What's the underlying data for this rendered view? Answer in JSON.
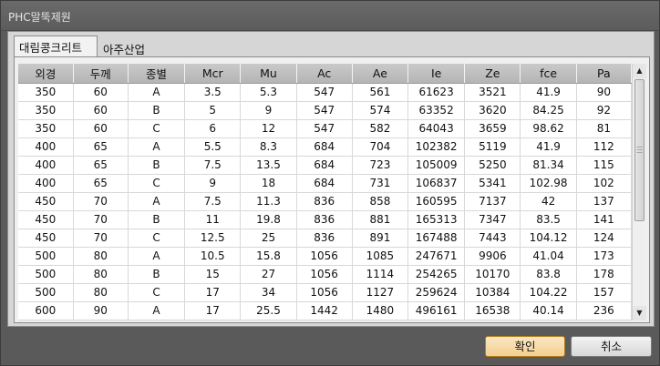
{
  "window": {
    "title": "PHC말뚝제원"
  },
  "tabs": [
    {
      "label": "대림콩크리트",
      "active": true
    },
    {
      "label": "아주산업",
      "active": false
    }
  ],
  "table": {
    "columns": [
      "외경",
      "두께",
      "종별",
      "Mcr",
      "Mu",
      "Ac",
      "Ae",
      "Ie",
      "Ze",
      "fce",
      "Pa"
    ],
    "rows": [
      [
        "350",
        "60",
        "A",
        "3.5",
        "5.3",
        "547",
        "561",
        "61623",
        "3521",
        "41.9",
        "90"
      ],
      [
        "350",
        "60",
        "B",
        "5",
        "9",
        "547",
        "574",
        "63352",
        "3620",
        "84.25",
        "92"
      ],
      [
        "350",
        "60",
        "C",
        "6",
        "12",
        "547",
        "582",
        "64043",
        "3659",
        "98.62",
        "81"
      ],
      [
        "400",
        "65",
        "A",
        "5.5",
        "8.3",
        "684",
        "704",
        "102382",
        "5119",
        "41.9",
        "112"
      ],
      [
        "400",
        "65",
        "B",
        "7.5",
        "13.5",
        "684",
        "723",
        "105009",
        "5250",
        "81.34",
        "115"
      ],
      [
        "400",
        "65",
        "C",
        "9",
        "18",
        "684",
        "731",
        "106837",
        "5341",
        "102.98",
        "102"
      ],
      [
        "450",
        "70",
        "A",
        "7.5",
        "11.3",
        "836",
        "858",
        "160595",
        "7137",
        "42",
        "137"
      ],
      [
        "450",
        "70",
        "B",
        "11",
        "19.8",
        "836",
        "881",
        "165313",
        "7347",
        "83.5",
        "141"
      ],
      [
        "450",
        "70",
        "C",
        "12.5",
        "25",
        "836",
        "891",
        "167488",
        "7443",
        "104.12",
        "124"
      ],
      [
        "500",
        "80",
        "A",
        "10.5",
        "15.8",
        "1056",
        "1085",
        "247671",
        "9906",
        "41.04",
        "173"
      ],
      [
        "500",
        "80",
        "B",
        "15",
        "27",
        "1056",
        "1114",
        "254265",
        "10170",
        "83.8",
        "178"
      ],
      [
        "500",
        "80",
        "C",
        "17",
        "34",
        "1056",
        "1127",
        "259624",
        "10384",
        "104.22",
        "157"
      ],
      [
        "600",
        "90",
        "A",
        "17",
        "25.5",
        "1442",
        "1480",
        "496161",
        "16538",
        "40.14",
        "236"
      ]
    ]
  },
  "buttons": {
    "ok": "확인",
    "cancel": "취소"
  }
}
